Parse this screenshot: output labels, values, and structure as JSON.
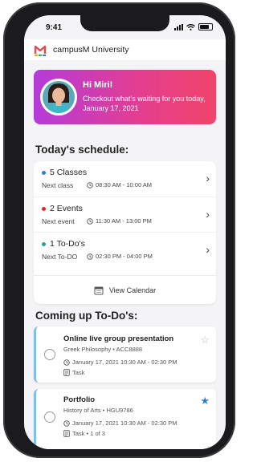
{
  "status": {
    "time": "9:41"
  },
  "header": {
    "app_name": "campusM University"
  },
  "greeting": {
    "hello": "Hi Miri!",
    "message": "Checkout what's waiting for you today, January 17, 2021"
  },
  "schedule": {
    "title": "Today's schedule:",
    "items": [
      {
        "title": "5 Classes",
        "next_label": "Next class",
        "time": "08:30 AM - 10:00 AM",
        "dot_color": "#2f7fd1"
      },
      {
        "title": "2 Events",
        "next_label": "Next event",
        "time": "11:30 AM - 13:00 PM",
        "dot_color": "#e02727"
      },
      {
        "title": "1 To-Do's",
        "next_label": "Next To-DO",
        "time": "02:30 PM - 04:00 PM",
        "dot_color": "#2e9e94"
      }
    ],
    "view_calendar": "View Calendar"
  },
  "todos": {
    "title": "Coming up To-Do's:",
    "items": [
      {
        "title": "Online live group presentation",
        "course": "Greek Philosophy • ACC8888",
        "datetime": "January 17, 2021 10:30 AM - 02:30 PM",
        "type": "Task",
        "starred": false
      },
      {
        "title": "Portfolio",
        "course": "History of Arts • HGU9786",
        "datetime": "January 17, 2021 10:30 AM - 02:30 PM",
        "type": "Task • 1 of 3",
        "starred": true
      }
    ]
  },
  "colors": {
    "accent_blue": "#2f7fd1",
    "gradient_start": "#b43bd9",
    "gradient_end": "#f0446a"
  }
}
